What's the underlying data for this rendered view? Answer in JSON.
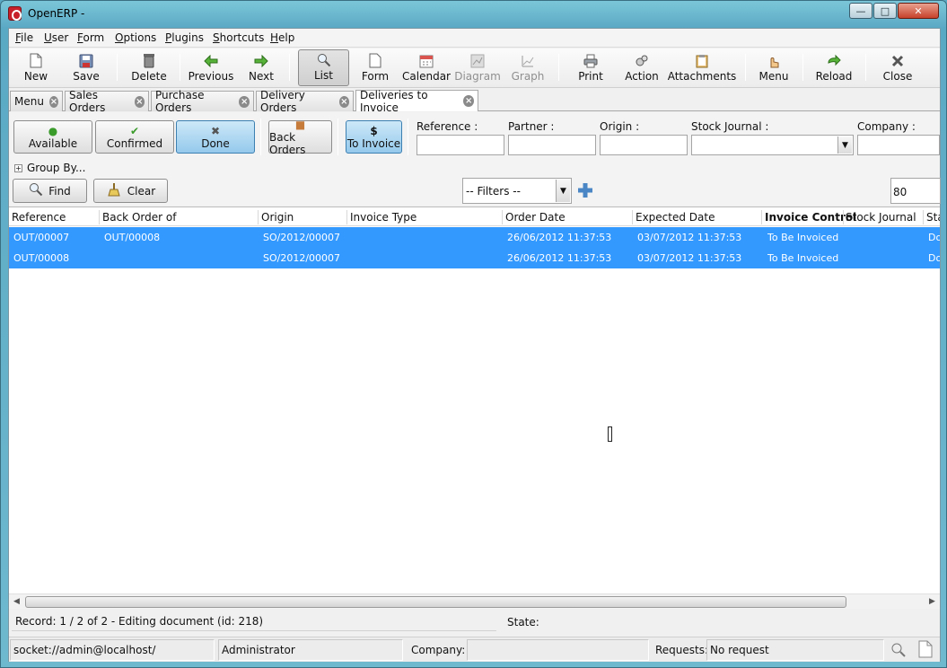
{
  "window": {
    "title": "OpenERP -"
  },
  "menubar": {
    "items": [
      {
        "label": "File",
        "mnemonic": "F",
        "rest": "ile"
      },
      {
        "label": "User",
        "mnemonic": "U",
        "rest": "ser"
      },
      {
        "label": "Form",
        "mnemonic": "F",
        "rest": "orm"
      },
      {
        "label": "Options",
        "mnemonic": "O",
        "rest": "ptions"
      },
      {
        "label": "Plugins",
        "mnemonic": "P",
        "rest": "lugins"
      },
      {
        "label": "Shortcuts",
        "mnemonic": "S",
        "rest": "hortcuts"
      },
      {
        "label": "Help",
        "mnemonic": "H",
        "rest": "elp"
      }
    ]
  },
  "toolbar": {
    "new": "New",
    "save": "Save",
    "delete": "Delete",
    "previous": "Previous",
    "next": "Next",
    "list": "List",
    "form": "Form",
    "calendar": "Calendar",
    "diagram": "Diagram",
    "graph": "Graph",
    "print": "Print",
    "action": "Action",
    "attachments": "Attachments",
    "menu": "Menu",
    "reload": "Reload",
    "close": "Close"
  },
  "tabs": [
    {
      "label": "Menu"
    },
    {
      "label": "Sales Orders"
    },
    {
      "label": "Purchase Orders"
    },
    {
      "label": "Delivery Orders"
    },
    {
      "label": "Deliveries to Invoice",
      "active": true
    }
  ],
  "search": {
    "filters": {
      "available": "Available",
      "confirmed": "Confirmed",
      "done": "Done",
      "back_orders": "Back Orders",
      "to_invoice": "To Invoice",
      "to_invoice_symbol": "$"
    },
    "fields": {
      "reference": {
        "label": "Reference :",
        "value": ""
      },
      "partner": {
        "label": "Partner :",
        "value": ""
      },
      "origin": {
        "label": "Origin :",
        "value": ""
      },
      "stock_journal": {
        "label": "Stock Journal :",
        "value": ""
      },
      "company": {
        "label": "Company :",
        "value": ""
      }
    },
    "group_by": "Group By...",
    "find": "Find",
    "clear": "Clear",
    "filters_select": "-- Filters --",
    "limit": "80"
  },
  "list": {
    "columns": [
      "Reference",
      "Back Order of",
      "Origin",
      "Invoice Type",
      "Order Date",
      "Expected Date",
      "Invoice Control",
      "Stock Journal",
      "Sta"
    ],
    "rows": [
      {
        "reference": "OUT/00007",
        "back_order_of": "OUT/00008",
        "origin": "SO/2012/00007",
        "invoice_type": "",
        "order_date": "26/06/2012 11:37:53",
        "expected_date": "03/07/2012 11:37:53",
        "invoice_control": "To Be Invoiced",
        "stock_journal": "",
        "state": "Do"
      },
      {
        "reference": "OUT/00008",
        "back_order_of": "",
        "origin": "SO/2012/00007",
        "invoice_type": "",
        "order_date": "26/06/2012 11:37:53",
        "expected_date": "03/07/2012 11:37:53",
        "invoice_control": "To Be Invoiced",
        "stock_journal": "",
        "state": "Do"
      }
    ]
  },
  "record_bar": {
    "record": "Record: 1 / 2 of 2 - Editing document (id: 218)",
    "state_label": "State:"
  },
  "statusbar": {
    "server": "socket://admin@localhost/",
    "user": "Administrator",
    "company_label": "Company:",
    "company_value": "",
    "requests_label": "Requests:",
    "requests_value": "No request"
  },
  "colors": {
    "selection": "#3399ff",
    "pressed_filter": "#95c9ec"
  }
}
